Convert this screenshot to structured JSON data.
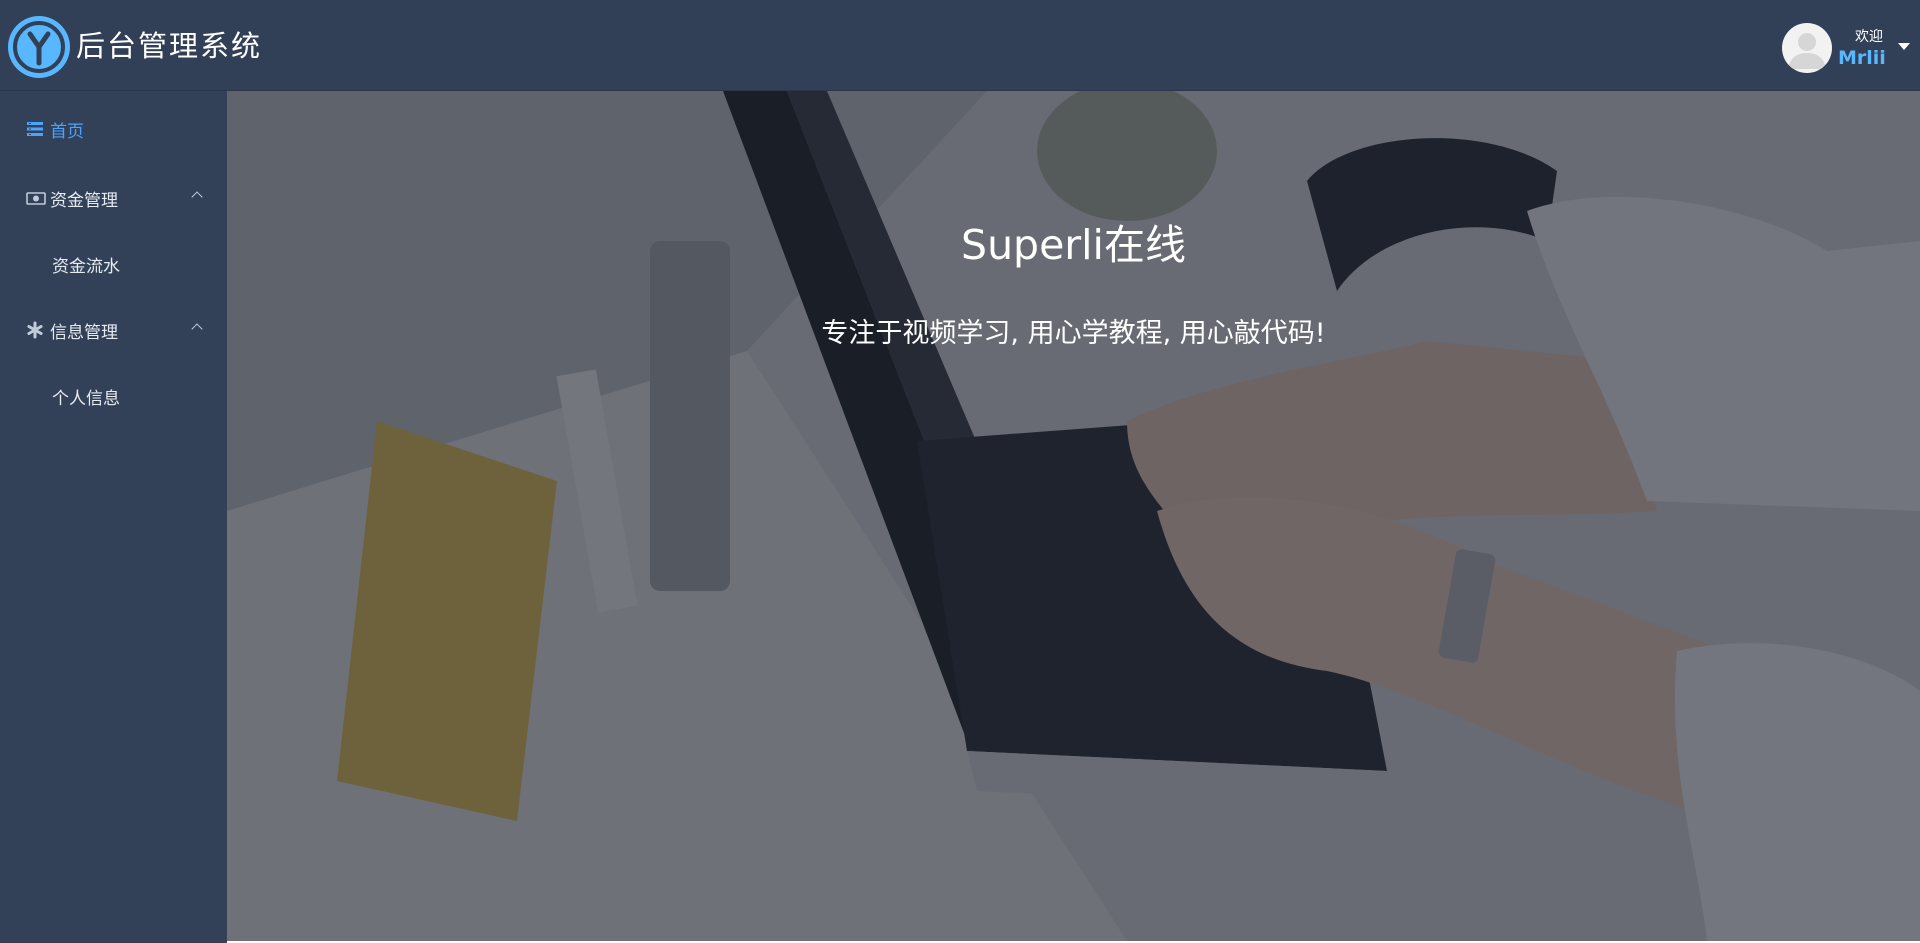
{
  "header": {
    "app_title": "后台管理系统",
    "welcome_text": "欢迎",
    "username": "Mrlii"
  },
  "sidebar": {
    "items": [
      {
        "label": "首页",
        "icon": "list-icon",
        "active": true
      },
      {
        "label": "资金管理",
        "icon": "money-icon",
        "expanded": true,
        "children": [
          {
            "label": "资金流水"
          }
        ]
      },
      {
        "label": "信息管理",
        "icon": "gear-icon",
        "expanded": true,
        "children": [
          {
            "label": "个人信息"
          }
        ]
      }
    ]
  },
  "main": {
    "hero_title": "Superli在线",
    "hero_subtitle": "专注于视频学习, 用心学教程, 用心敲代码!"
  },
  "colors": {
    "header_bg": "#324057",
    "sidebar_bg": "#324157",
    "accent": "#58b7ff",
    "active_menu": "#4aa3ff"
  }
}
